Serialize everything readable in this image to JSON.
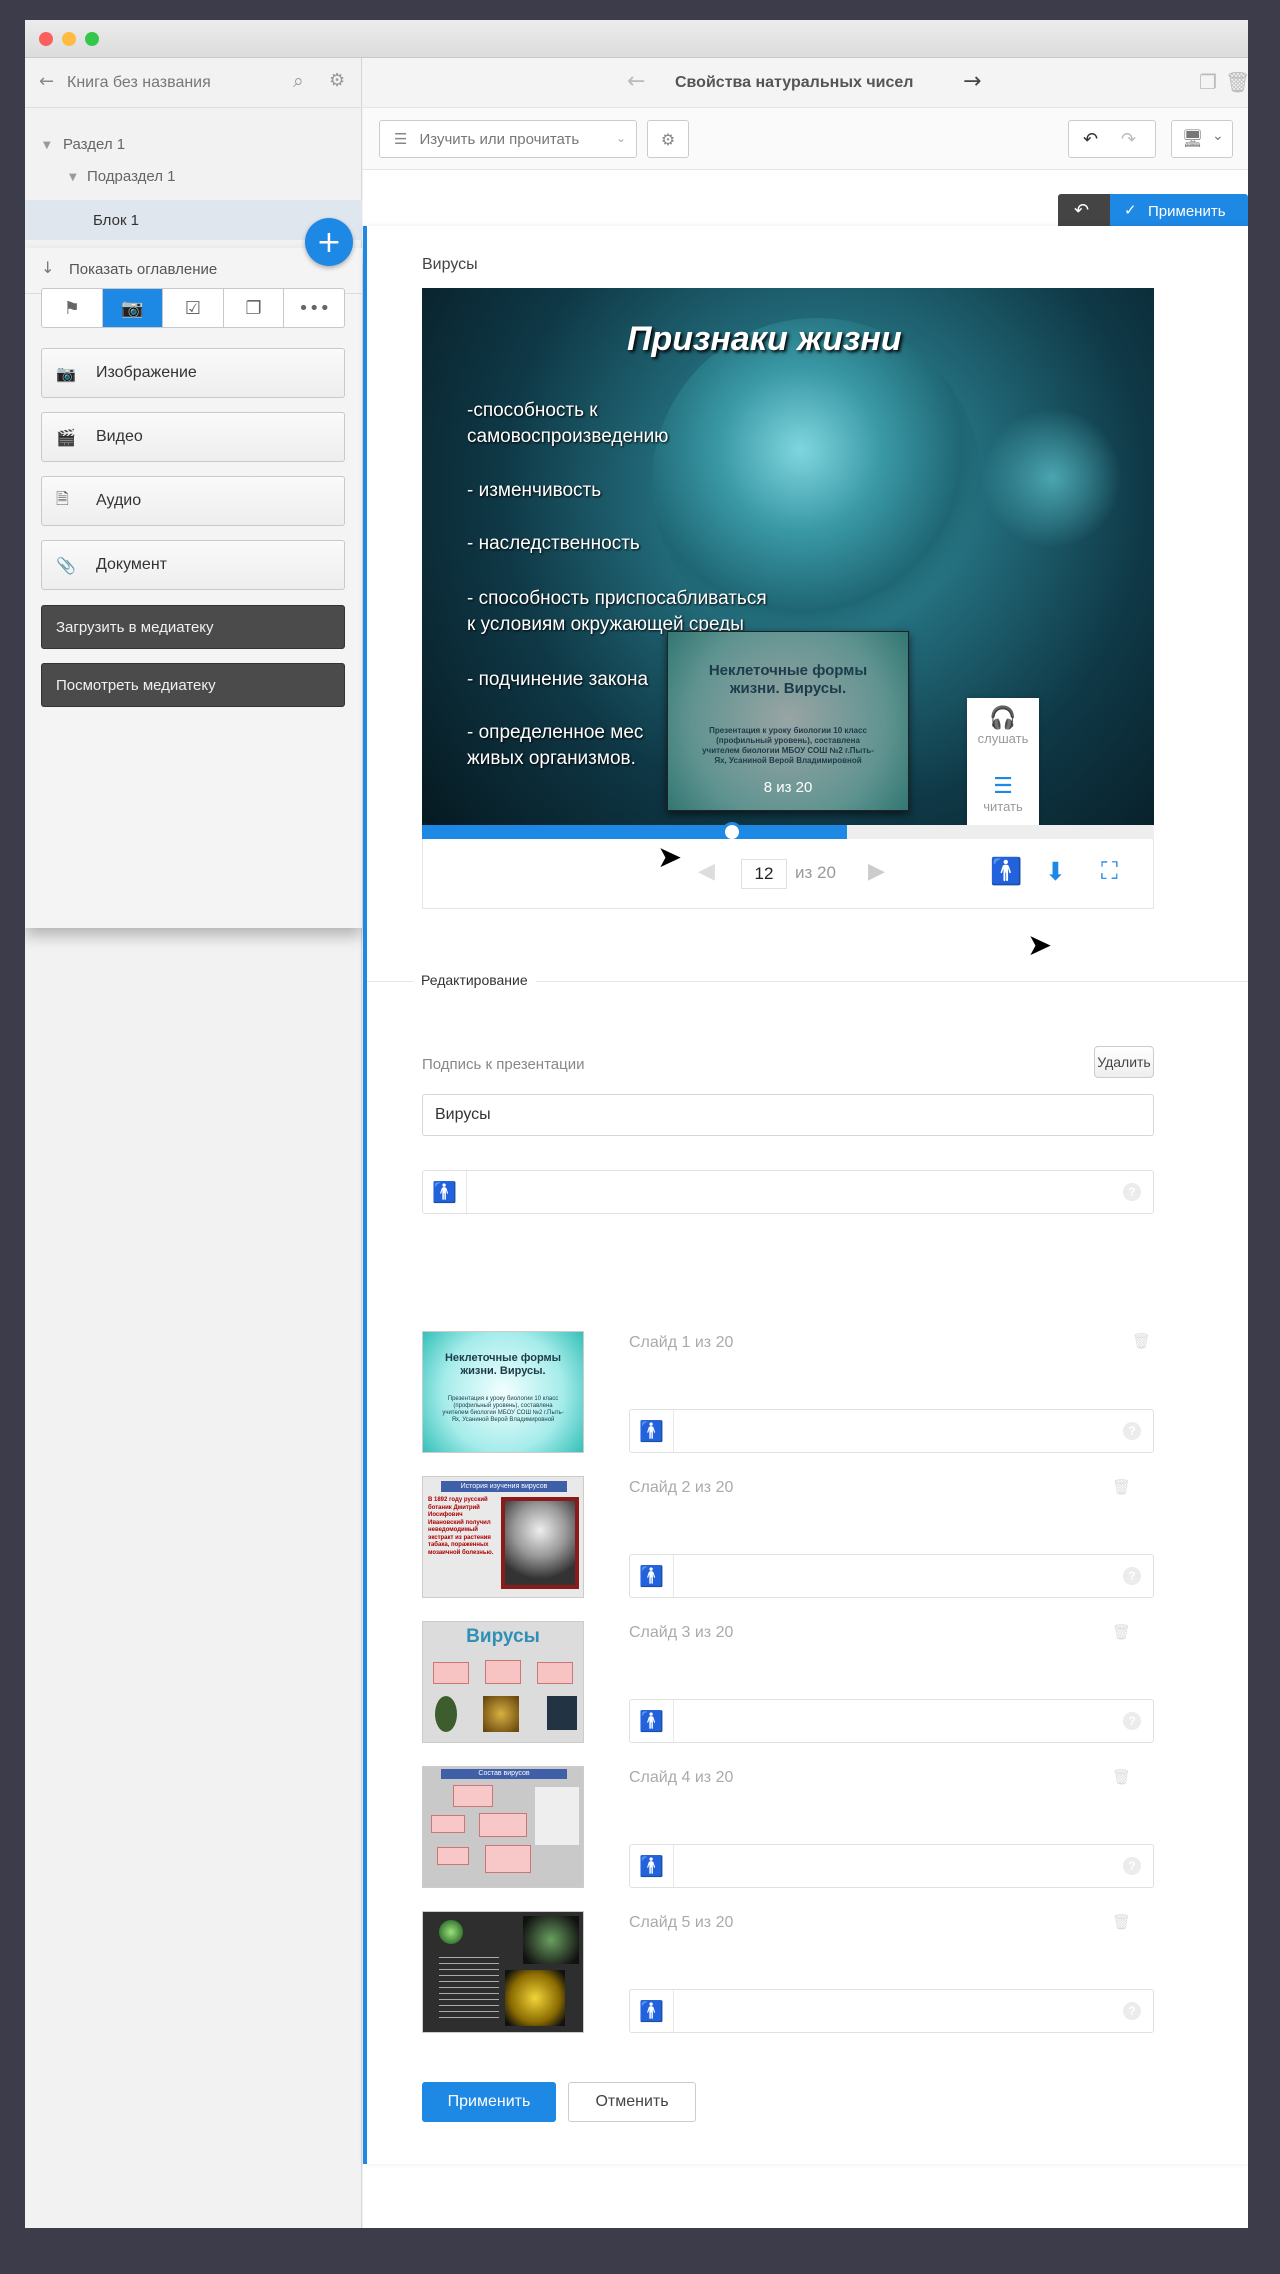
{
  "app": {
    "book_title": "Книга без названия",
    "page_title": "Свойства натуральных чисел"
  },
  "tree": {
    "section": "Раздел 1",
    "subsection": "Подраздел 1",
    "block": "Блок 1",
    "show_toc": "Показать оглавление"
  },
  "media_panel": {
    "tabs": [
      "flag-icon",
      "camera-icon",
      "checkbox-icon",
      "layers-icon",
      "more-icon"
    ],
    "buttons": {
      "image": "Изображение",
      "video": "Видео",
      "audio": "Аудио",
      "document": "Документ"
    },
    "upload": "Загрузить в медиатеку",
    "view_library": "Посмотреть медиатеку"
  },
  "toolbar": {
    "mode_select": "Изучить или прочитать",
    "apply": "Применить"
  },
  "viewer": {
    "title": "Вирусы",
    "slide_heading": "Признаки жизни",
    "slide_lines": [
      "-способность к",
      "самовоспроизведению",
      "- изменчивость",
      "- наследственность",
      "- способность приспосабливаться",
      "к условиям окружающей среды",
      "- подчинение закона",
      "- определенное мес",
      "живых организмов."
    ],
    "preview": {
      "title": "Неклеточные формы жизни. Вирусы.",
      "sub": "Презентация к уроку биологии 10 класс (профильный уровень), составлена учителем биологии МБОУ СОШ №2 г.Пыть-Ях, Усаниной Верой Владимировной",
      "counter": "8 из 20"
    },
    "progress": 0.58,
    "current_page": "12",
    "of_total": "из 20",
    "listen": "слушать",
    "read": "читать"
  },
  "editing": {
    "section_label": "Редактирование",
    "caption_label": "Подпись к презентации",
    "delete": "Удалить",
    "caption_value": "Вирусы",
    "slides": [
      {
        "label": "Слайд 1 из 20"
      },
      {
        "label": "Слайд 2 из 20"
      },
      {
        "label": "Слайд 3 из 20"
      },
      {
        "label": "Слайд 4 из 20"
      },
      {
        "label": "Слайд 5 из 20"
      }
    ],
    "thumbs": {
      "t1_title": "Неклеточные формы жизни. Вирусы.",
      "t1_sub": "Презентация к уроку биологии 10 класс (профильный уровень), составлена учителем биологии МБОУ СОШ №2 г.Пыть-Ях, Усаниной Верой Владимировной",
      "t2_title": "История изучения вирусов",
      "t2_text": "В 1892 году русский ботаник Дмитрий Иосифович Ивановский получил неведомодимый экстракт из растения табака, пораженных мозаичной болезнью.",
      "t3_title": "Вирусы",
      "t4_title": "Состав вирусов"
    },
    "apply": "Применить",
    "cancel": "Отменить"
  },
  "colors": {
    "accent": "#1e88e5",
    "dark_button": "#4b4b4b"
  }
}
